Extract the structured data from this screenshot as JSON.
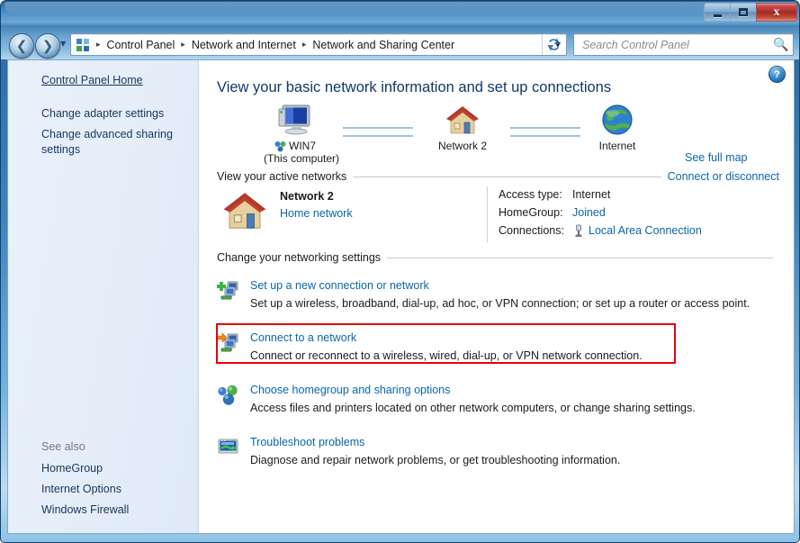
{
  "window": {
    "minimize_label": "Minimize",
    "maximize_label": "Maximize",
    "close_label": "Close"
  },
  "nav": {
    "back_label": "Back",
    "forward_label": "Forward",
    "history_label": "Recent pages",
    "refresh_label": "Refresh",
    "address_icon": "control-panel-icon",
    "breadcrumbs": [
      "Control Panel",
      "Network and Internet",
      "Network and Sharing Center"
    ],
    "separator": "▸",
    "dropdown_glyph": "▼",
    "refresh_glyph": "↻"
  },
  "search": {
    "placeholder": "Search Control Panel",
    "value": "",
    "icon": "search-icon"
  },
  "sidebar": {
    "home_label": "Control Panel Home",
    "items": [
      {
        "label": "Change adapter settings"
      },
      {
        "label": "Change advanced sharing settings"
      }
    ],
    "see_also_title": "See also",
    "see_also": [
      {
        "label": "HomeGroup"
      },
      {
        "label": "Internet Options"
      },
      {
        "label": "Windows Firewall"
      }
    ]
  },
  "content": {
    "help_glyph": "?",
    "page_title": "View your basic network information and set up connections",
    "map": {
      "see_full_map": "See full map",
      "nodes": [
        {
          "icon": "computer-icon",
          "label": "WIN7",
          "sublabel": "(This computer)"
        },
        {
          "icon": "house-icon",
          "label": "Network  2",
          "sublabel": ""
        },
        {
          "icon": "globe-icon",
          "label": "Internet",
          "sublabel": ""
        }
      ]
    },
    "active_networks": {
      "heading": "View your active networks",
      "right_link": "Connect or disconnect",
      "network_icon": "house-icon",
      "network_name": "Network  2",
      "network_type": "Home network",
      "properties": [
        {
          "key": "Access type:",
          "value": "Internet",
          "is_link": false,
          "icon": ""
        },
        {
          "key": "HomeGroup:",
          "value": "Joined",
          "is_link": true,
          "icon": ""
        },
        {
          "key": "Connections:",
          "value": "Local Area Connection",
          "is_link": true,
          "icon": "ethernet-icon"
        }
      ]
    },
    "settings": {
      "heading": "Change your networking settings",
      "links": [
        {
          "icon": "new-connection-icon",
          "title": "Set up a new connection or network",
          "desc": "Set up a wireless, broadband, dial-up, ad hoc, or VPN connection; or set up a router or access point.",
          "highlighted": false
        },
        {
          "icon": "connect-network-icon",
          "title": "Connect to a network",
          "desc": "Connect or reconnect to a wireless, wired, dial-up, or VPN network connection.",
          "highlighted": true
        },
        {
          "icon": "homegroup-icon",
          "title": "Choose homegroup and sharing options",
          "desc": "Access files and printers located on other network computers, or change sharing settings.",
          "highlighted": false
        },
        {
          "icon": "troubleshoot-icon",
          "title": "Troubleshoot problems",
          "desc": "Diagnose and repair network problems, or get troubleshooting information.",
          "highlighted": false
        }
      ]
    }
  },
  "colors": {
    "link": "#0b66a9",
    "title": "#123769",
    "highlight": "#e8000b",
    "titlebar": "#2e6ea8"
  }
}
